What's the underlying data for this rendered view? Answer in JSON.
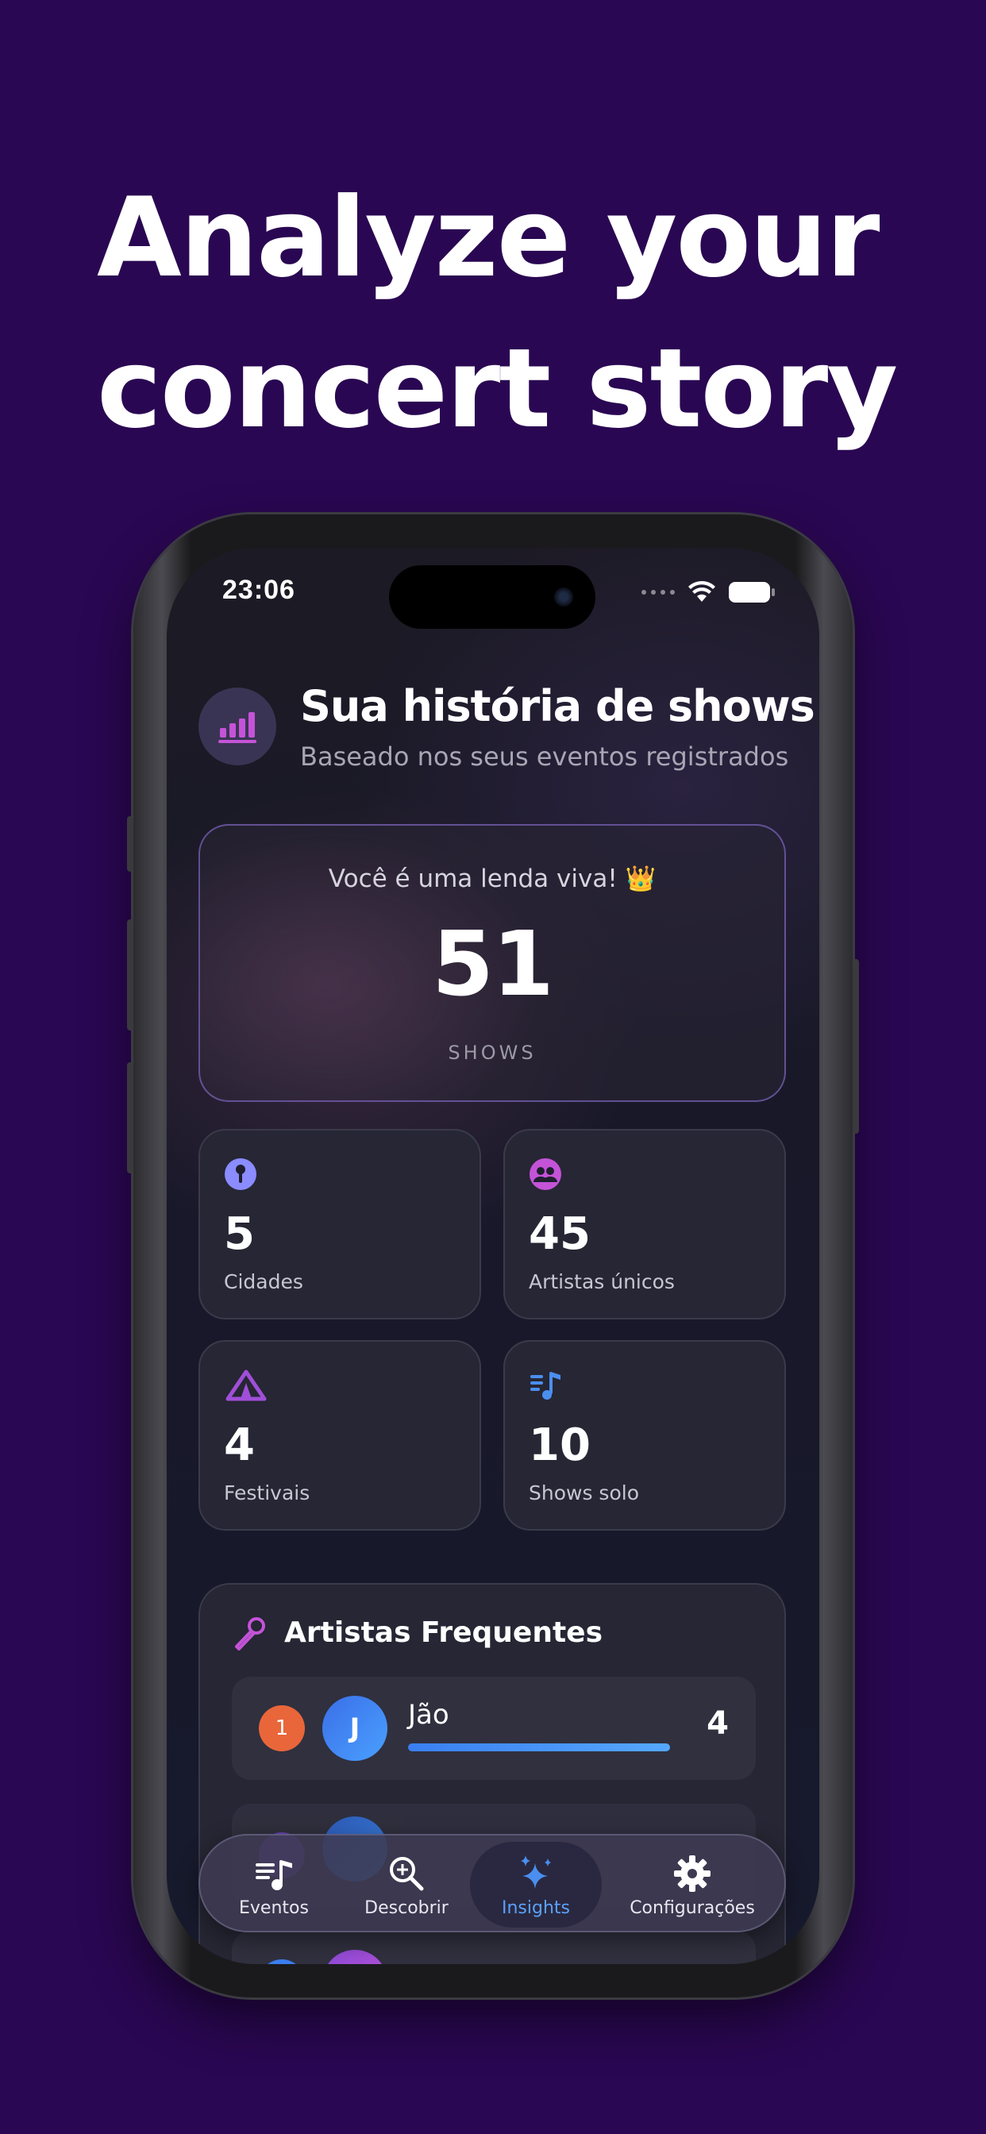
{
  "headline": {
    "line1": "Analyze your",
    "line2": "concert story"
  },
  "status_bar": {
    "time": "23:06"
  },
  "header": {
    "title": "Sua história de shows",
    "subtitle": "Baseado nos seus eventos registrados",
    "icon": "chart-bars-icon"
  },
  "hero": {
    "message": "Você é uma lenda viva! 👑",
    "value": "51",
    "label": "SHOWS"
  },
  "stats": [
    {
      "value": "5",
      "label": "Cidades",
      "icon": "pin-icon",
      "color": "#7f8cff"
    },
    {
      "value": "45",
      "label": "Artistas únicos",
      "icon": "people-icon",
      "color": "#c453d8"
    },
    {
      "value": "4",
      "label": "Festivais",
      "icon": "tent-icon",
      "color": "#a04fd8"
    },
    {
      "value": "10",
      "label": "Shows solo",
      "icon": "music-list-icon",
      "color": "#4a8ff0"
    }
  ],
  "frequent_artists": {
    "title": "Artistas Frequentes",
    "icon": "microphone-icon",
    "rows": [
      {
        "rank": "1",
        "initial": "J",
        "name": "Jão",
        "count": "4",
        "progress": 1.0,
        "rank_color": "#e8663a"
      }
    ]
  },
  "tabs": [
    {
      "label": "Eventos",
      "icon": "music-list-icon"
    },
    {
      "label": "Descobrir",
      "icon": "magnify-icon"
    },
    {
      "label": "Insights",
      "icon": "sparkles-icon",
      "active": true
    },
    {
      "label": "Configurações",
      "icon": "gear-icon"
    }
  ],
  "colors": {
    "background": "#2a0752",
    "accent": "#5aa2ff"
  }
}
